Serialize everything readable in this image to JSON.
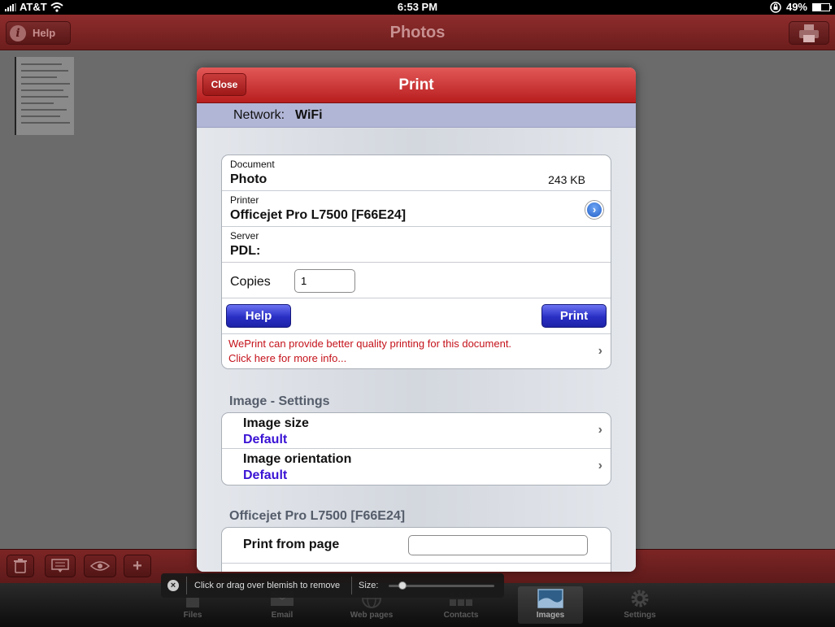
{
  "status_bar": {
    "carrier": "AT&T",
    "time": "6:53 PM",
    "battery_percent": "49%",
    "battery_level": 0.49
  },
  "nav_bar": {
    "title": "Photos",
    "help_label": "Help"
  },
  "print_dialog": {
    "close_label": "Close",
    "title": "Print",
    "network_label": "Network:",
    "network_value": "WiFi",
    "document_label": "Document",
    "document_name": "Photo",
    "document_size": "243 KB",
    "printer_label": "Printer",
    "printer_name": "Officejet Pro L7500 [F66E24]",
    "server_label": "Server",
    "server_value": "PDL:",
    "copies_label": "Copies",
    "copies_value": "1",
    "help_button": "Help",
    "print_button": "Print",
    "weprint_line1": "WePrint can provide better quality printing for this document.",
    "weprint_line2": "Click here for more info...",
    "image_settings_title": "Image - Settings",
    "image_size_label": "Image size",
    "image_size_value": "Default",
    "image_orientation_label": "Image orientation",
    "image_orientation_value": "Default",
    "printer_section_title": "Officejet Pro L7500 [F66E24]",
    "print_from_page_label": "Print from page",
    "print_from_page_value": ""
  },
  "blemish_tool": {
    "hint": "Click or drag over blemish to remove",
    "size_label": "Size:",
    "size_level": 0.1
  },
  "tab_bar": {
    "tabs": [
      {
        "label": "Files",
        "icon": "files-icon"
      },
      {
        "label": "Email",
        "icon": "email-icon"
      },
      {
        "label": "Web pages",
        "icon": "globe-icon"
      },
      {
        "label": "Contacts",
        "icon": "contacts-icon"
      },
      {
        "label": "Images",
        "icon": "images-icon"
      },
      {
        "label": "Settings",
        "icon": "gear-icon"
      }
    ],
    "active_tab": "Images"
  },
  "colors": {
    "nav_red": "#7a2424",
    "dialog_header_red": "#d03636",
    "button_blue": "#2a2fc4",
    "link_red": "#c4121a",
    "setting_value_purple": "#3a13d4"
  }
}
